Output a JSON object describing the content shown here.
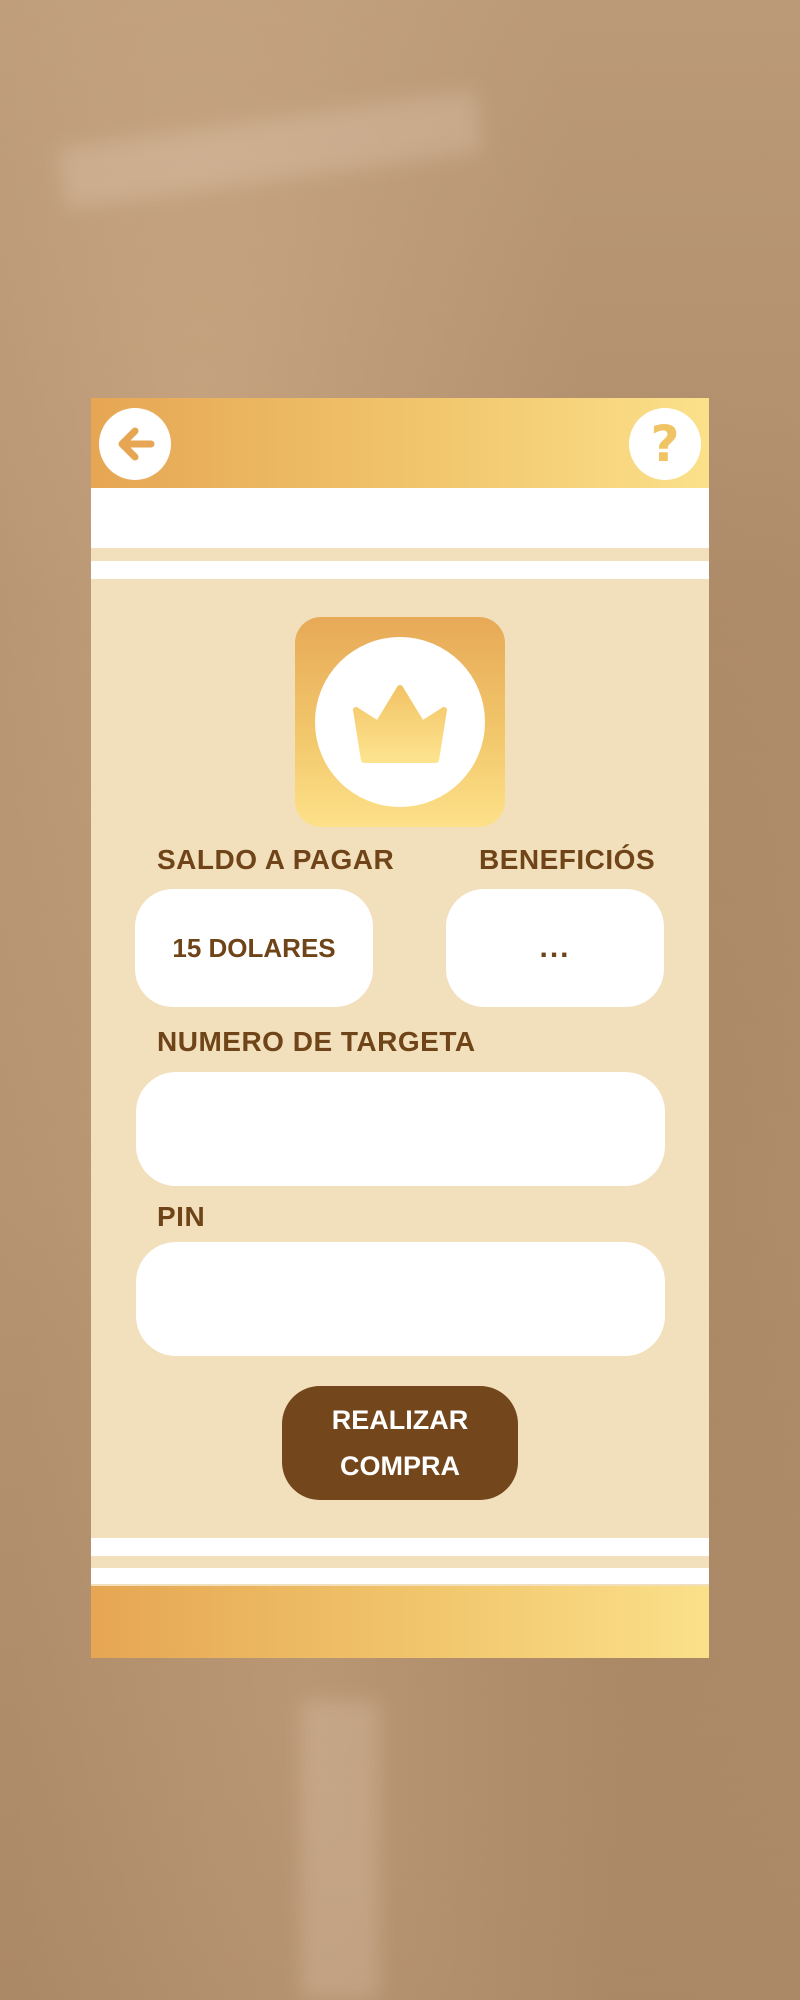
{
  "header": {
    "back_icon": "arrow-left-icon",
    "help_icon": "question-mark-icon",
    "help_glyph": "?"
  },
  "logo": {
    "icon": "crown-icon"
  },
  "payment": {
    "saldo_label": "SALDO A PAGAR",
    "saldo_value": "15 DOLARES",
    "beneficios_label": "BENEFICIÓS",
    "beneficios_value": "...",
    "card_label": "NUMERO DE TARGETA",
    "card_value": "",
    "pin_label": "PIN",
    "pin_value": ""
  },
  "actions": {
    "buy_line1": "REALIZAR",
    "buy_line2": "COMPRA"
  },
  "colors": {
    "gold_start": "#e6a654",
    "gold_end": "#fbe08a",
    "panel": "#f2dfbc",
    "brown": "#74461b",
    "text_brown": "#6f4418"
  }
}
